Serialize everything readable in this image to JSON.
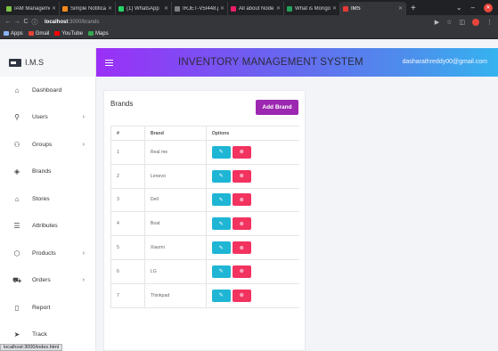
{
  "browser": {
    "tabs": [
      {
        "label": "IAM Managemen",
        "favicon_color": "#7cc144"
      },
      {
        "label": "Simple Notificat",
        "favicon_color": "#f7891c"
      },
      {
        "label": "(1) WhatsApp",
        "favicon_color": "#25d366"
      },
      {
        "label": "IRJET-V5I448.p",
        "favicon_color": "#7a7f86"
      },
      {
        "label": "All about Node.",
        "favicon_color": "#e91e63"
      },
      {
        "label": "What is Mongo",
        "favicon_color": "#23a05a"
      },
      {
        "label": "IMS",
        "favicon_color": "#e53935",
        "active": true
      }
    ],
    "address": {
      "host": "localhost",
      "rest": ":3000/brands"
    },
    "bookmarks": [
      {
        "label": "Apps",
        "icon": "apps-grid-icon",
        "color": "#8ab4f8"
      },
      {
        "label": "Gmail",
        "icon": "gmail-icon",
        "color": "#ea4335"
      },
      {
        "label": "YouTube",
        "icon": "youtube-icon",
        "color": "#ff0000"
      },
      {
        "label": "Maps",
        "icon": "maps-icon",
        "color": "#34a853"
      }
    ],
    "status_url": "localhost:3000/index.html"
  },
  "app": {
    "brand_name": "I.M.S",
    "title": "INVENTORY MANAGEMENT SYSTEM",
    "user_email": "dasharathreddy00@gmail.com",
    "gradient": [
      "#9b2ff7",
      "#35b3ef"
    ]
  },
  "sidebar": {
    "items": [
      {
        "label": "Dashboard",
        "icon": "home-icon",
        "glyph": "⌂",
        "has_submenu": false
      },
      {
        "label": "Users",
        "icon": "user-icon",
        "glyph": "⚲",
        "has_submenu": true
      },
      {
        "label": "Groups",
        "icon": "group-icon",
        "glyph": "⚇",
        "has_submenu": true
      },
      {
        "label": "Brands",
        "icon": "layers-icon",
        "glyph": "◈",
        "has_submenu": false
      },
      {
        "label": "Stores",
        "icon": "store-icon",
        "glyph": "⌂",
        "has_submenu": false
      },
      {
        "label": "Attributes",
        "icon": "list-icon",
        "glyph": "☰",
        "has_submenu": false
      },
      {
        "label": "Products",
        "icon": "box-icon",
        "glyph": "⬡",
        "has_submenu": true
      },
      {
        "label": "Orders",
        "icon": "cart-icon",
        "glyph": "⛟",
        "has_submenu": true
      },
      {
        "label": "Report",
        "icon": "document-icon",
        "glyph": "▯",
        "has_submenu": false
      },
      {
        "label": "Track",
        "icon": "navigation-icon",
        "glyph": "➤",
        "has_submenu": false
      }
    ]
  },
  "brands_panel": {
    "heading": "Brands",
    "add_button": "Add Brand",
    "columns": [
      "#",
      "Brand",
      "Options"
    ],
    "rows": [
      {
        "num": "1",
        "brand": "Real me"
      },
      {
        "num": "2",
        "brand": "Lenevo"
      },
      {
        "num": "3",
        "brand": "Dell"
      },
      {
        "num": "4",
        "brand": "Boat"
      },
      {
        "num": "5",
        "brand": "Xiaomi"
      },
      {
        "num": "6",
        "brand": "LG"
      },
      {
        "num": "7",
        "brand": "Thinkpad"
      }
    ],
    "edit_color": "#1fb5d4",
    "delete_color": "#f2335f"
  }
}
